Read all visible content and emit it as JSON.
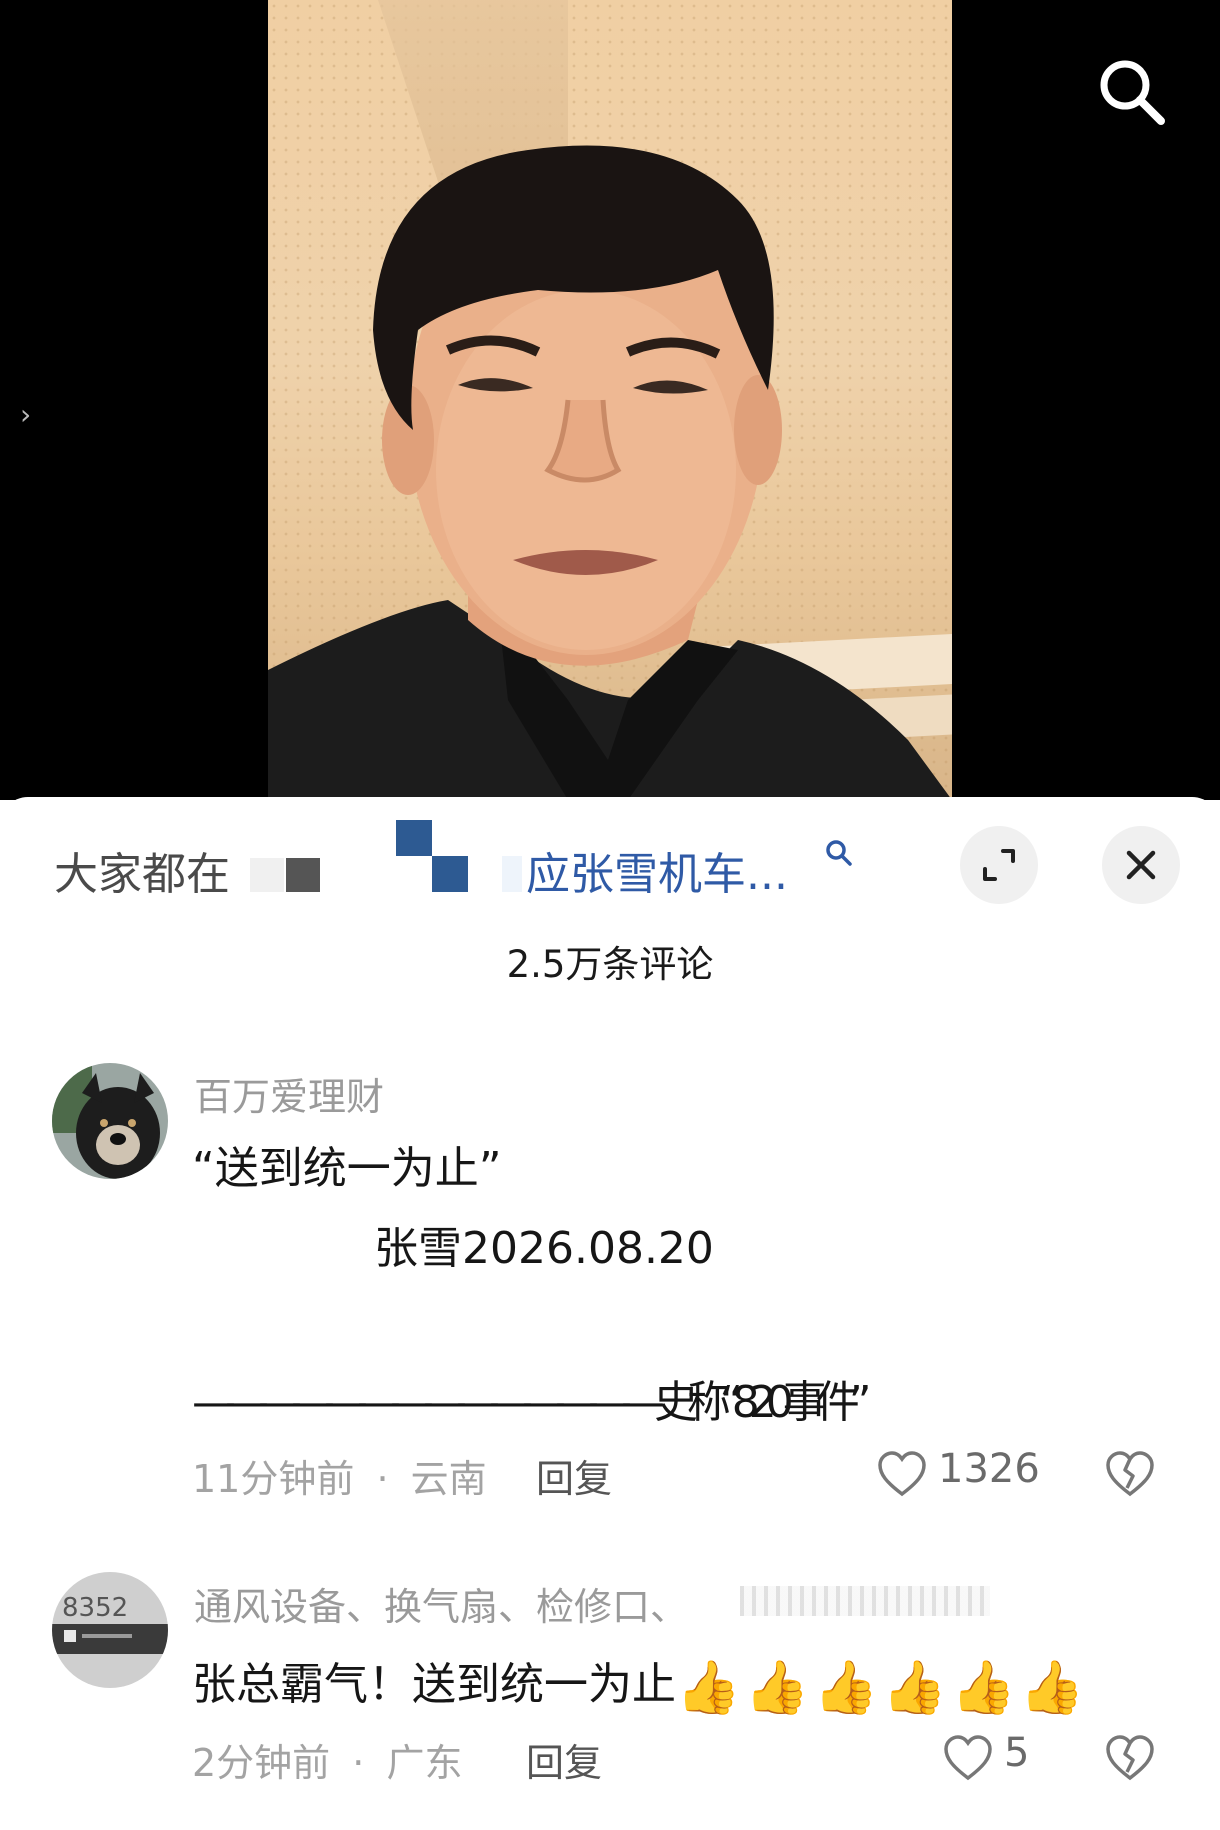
{
  "video": {
    "collapse_arrow": "›"
  },
  "comments_header": {
    "topic_prefix": "大家都在",
    "topic_suffix": "应张雪机车...",
    "count_label": "2.5万条评论"
  },
  "comments": [
    {
      "username": "百万爱理财",
      "lines": [
        "“送到统一为止”",
        "张雪2026.08.20",
        "——————————————史称“820事件”"
      ],
      "time": "11分钟前",
      "separator": "·",
      "location": "云南",
      "reply_label": "回复",
      "likes": "1326"
    },
    {
      "username": "通风设备、换气扇、检修口、",
      "text": "张总霸气！送到统一为止",
      "thumbs": [
        "👍",
        "👍",
        "👍",
        "👍",
        "👍",
        "👍"
      ],
      "avatar_text": "8352",
      "time": "2分钟前",
      "separator": "·",
      "location": "广东",
      "reply_label": "回复",
      "likes": "5"
    }
  ]
}
